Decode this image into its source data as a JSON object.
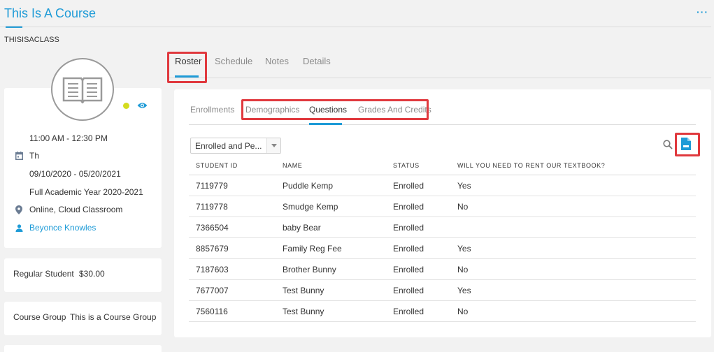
{
  "header": {
    "course_title": "This Is A Course",
    "class_code": "THISISACLASS",
    "more_label": "···"
  },
  "info": {
    "time": "11:00 AM - 12:30 PM",
    "days": "Th",
    "dates": "09/10/2020 - 05/20/2021",
    "term": "Full Academic Year 2020-2021",
    "location": "Online, Cloud Classroom",
    "instructor": "Beyonce Knowles",
    "status_color": "#d4dc1f"
  },
  "pricing": {
    "label": "Regular Student",
    "amount": "$30.00"
  },
  "group": {
    "label": "Course Group",
    "value": "This is a Course Group"
  },
  "main_tabs": [
    "Roster",
    "Schedule",
    "Notes",
    "Details"
  ],
  "sub_tabs": [
    "Enrollments",
    "Demographics",
    "Questions",
    "Grades And Credits"
  ],
  "filter": {
    "value": "Enrolled and Pe..."
  },
  "table": {
    "headers": [
      "STUDENT ID",
      "NAME",
      "STATUS",
      "WILL YOU NEED TO RENT OUR TEXTBOOK?"
    ],
    "rows": [
      [
        "7119779",
        "Puddle Kemp",
        "Enrolled",
        "Yes"
      ],
      [
        "7119778",
        "Smudge Kemp",
        "Enrolled",
        "No"
      ],
      [
        "7366504",
        "baby Bear",
        "Enrolled",
        ""
      ],
      [
        "8857679",
        "Family Reg Fee",
        "Enrolled",
        "Yes"
      ],
      [
        "7187603",
        "Brother Bunny",
        "Enrolled",
        "No"
      ],
      [
        "7677007",
        "Test Bunny",
        "Enrolled",
        "Yes"
      ],
      [
        "7560116",
        "Test Bunny",
        "Enrolled",
        "No"
      ]
    ]
  },
  "colors": {
    "accent": "#1e9bd7",
    "highlight": "#e0393e"
  },
  "icons": [
    "more-icon",
    "book-icon",
    "eye-icon",
    "calendar-icon",
    "location-pin-icon",
    "person-icon",
    "search-icon",
    "xls-file-icon",
    "caret-down-icon"
  ]
}
